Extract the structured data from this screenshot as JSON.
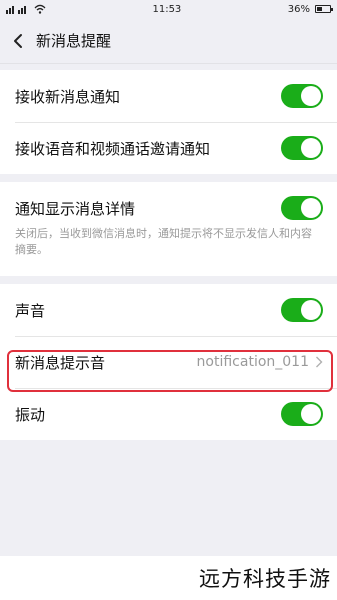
{
  "statusbar": {
    "carrier": "Ꮨıl",
    "time": "11:53",
    "battery": "36%"
  },
  "navbar": {
    "title": "新消息提醒"
  },
  "groups": {
    "g1": {
      "receive_new": {
        "label": "接收新消息通知",
        "on": true
      },
      "receive_voice_video": {
        "label": "接收语音和视频通话邀请通知",
        "on": true
      }
    },
    "g2": {
      "show_details": {
        "label": "通知显示消息详情",
        "on": true
      },
      "description": "关闭后，当收到微信消息时，通知提示将不显示发信人和内容摘要。"
    },
    "g3": {
      "sound": {
        "label": "声音",
        "on": true
      },
      "new_msg_tone": {
        "label": "新消息提示音",
        "value": "notification_011"
      },
      "vibrate": {
        "label": "振动",
        "on": true
      }
    }
  },
  "watermark": "远方科技手游",
  "colors": {
    "toggle_on": "#1aad19",
    "highlight": "#e0303c",
    "background": "#efeff4"
  }
}
